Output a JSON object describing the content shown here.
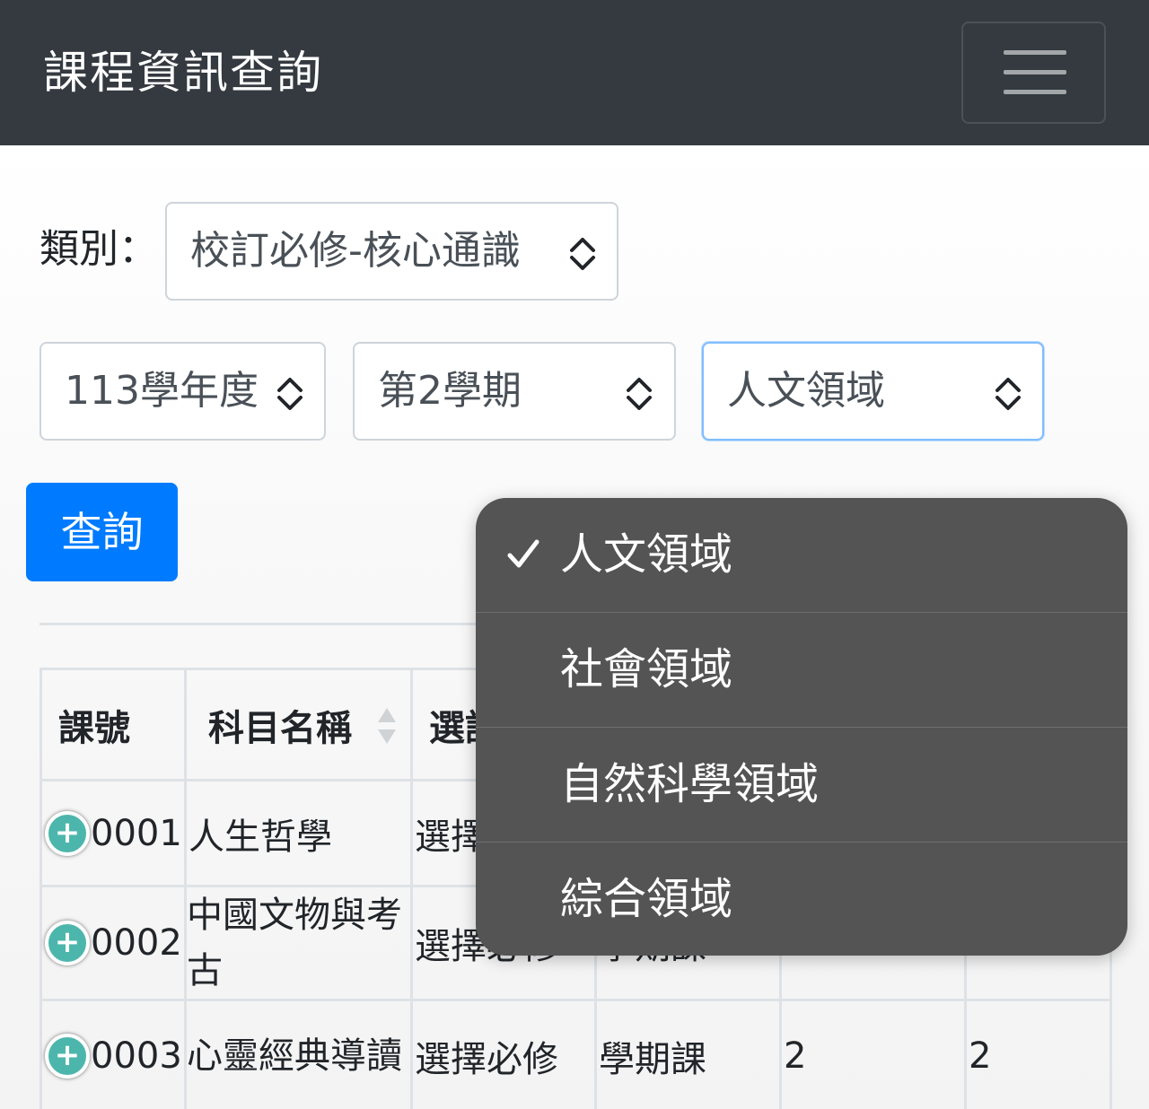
{
  "header": {
    "title": "課程資訊查詢",
    "menu_icon": "hamburger-menu-icon"
  },
  "filters": {
    "category_label": "類別：",
    "category_value": "校訂必修-核心通識",
    "year_value": "113學年度",
    "semester_value": "第2學期",
    "domain_value": "人文領域"
  },
  "query_button": "查詢",
  "table": {
    "headers": [
      "課號",
      "科目名稱",
      "選課"
    ],
    "rows": [
      {
        "code": "0001",
        "name": "人生哲學",
        "type": "選擇",
        "period": "",
        "c1": "",
        "c2": ""
      },
      {
        "code": "0002",
        "name": "中國文物與考古",
        "type": "選擇必修",
        "period": "學期課",
        "c1": "",
        "c2": ""
      },
      {
        "code": "0003",
        "name": "心靈經典導讀",
        "type": "選擇必修",
        "period": "學期課",
        "c1": "2",
        "c2": "2"
      }
    ]
  },
  "dropdown": {
    "selected": "人文領域",
    "options": [
      "人文領域",
      "社會領域",
      "自然科學領域",
      "綜合領域"
    ]
  },
  "colors": {
    "navbar": "#343a40",
    "primary": "#007bff",
    "plus": "#4db6ac",
    "dropdown_bg": "#545454"
  }
}
